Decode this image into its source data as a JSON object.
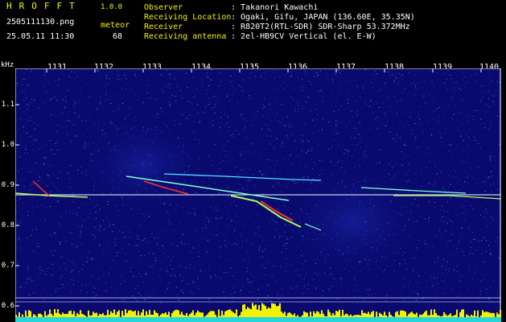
{
  "header": {
    "brand": "HROFFT",
    "version": "1.0.0",
    "filename": "2505111130.png",
    "datetime": "25.05.11 11:30",
    "meteor_label": "meteor",
    "meteor_count": "68"
  },
  "info": [
    {
      "label": "Observer",
      "value": ": Takanori Kawachi"
    },
    {
      "label": "Receiving Location",
      "value": ": Ogaki, Gifu, JAPAN (136.60E, 35.35N)"
    },
    {
      "label": "Receiver",
      "value": ": R820T2(RTL-SDR) SDR-Sharp 53.372MHz"
    },
    {
      "label": "Receiving antenna",
      "value": ": 2el-HB9CV Vertical (el. E-W)"
    }
  ],
  "axis": {
    "y_unit": "kHz",
    "x_ticks": [
      "1131",
      "1132",
      "1133",
      "1134",
      "1135",
      "1136",
      "1137",
      "1138",
      "1139",
      "1140"
    ],
    "y_ticks": [
      "1.1",
      "1.0",
      "0.9",
      "0.8",
      "0.7",
      "0.6"
    ]
  },
  "colors": {
    "background": "#000000",
    "plot_bg": "#0a0a6e",
    "label_yellow": "#f2f200",
    "label_white": "#ffffff",
    "label_green": "#33ff33",
    "signal_line": "#ffffff",
    "meteor_trail": "#ff3030",
    "power_bar": "#f2f200",
    "floor_bar": "#00d0ff"
  }
}
